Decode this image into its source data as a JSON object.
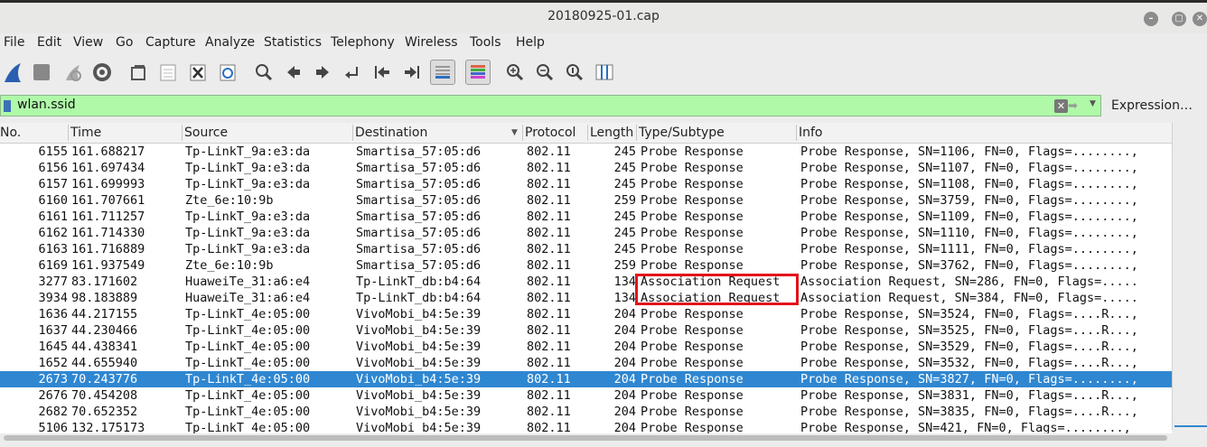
{
  "window": {
    "title": "20180925-01.cap",
    "minimize": "–",
    "maximize": "▢",
    "close": "✕"
  },
  "menu": [
    "File",
    "Edit",
    "View",
    "Go",
    "Capture",
    "Analyze",
    "Statistics",
    "Telephony",
    "Wireless",
    "Tools",
    "Help"
  ],
  "toolbar": [
    "shark-fin-icon",
    "stop-icon",
    "restart-icon",
    "options-gear-icon",
    "open-folder-icon",
    "save-file-icon",
    "close-file-icon",
    "reload-icon",
    "find-icon",
    "back-arrow-icon",
    "forward-arrow-icon",
    "go-to-packet-icon",
    "first-packet-icon",
    "last-packet-icon",
    "autoscroll-icon",
    "colorize-icon",
    "zoom-in-icon",
    "zoom-out-icon",
    "normal-size-icon",
    "resize-columns-icon"
  ],
  "filter": {
    "value": "wlan.ssid",
    "expression_label": "Expression…"
  },
  "columns": [
    "No.",
    "Time",
    "Source",
    "Destination",
    "Protocol",
    "Length",
    "Type/Subtype",
    "Info"
  ],
  "packets": [
    {
      "no": "6155",
      "time": "161.688217",
      "src": "Tp-LinkT_9a:e3:da",
      "dst": "Smartisa_57:05:d6",
      "proto": "802.11",
      "len": "245",
      "type": "Probe Response",
      "info": "Probe Response, SN=1106, FN=0, Flags=........,"
    },
    {
      "no": "6156",
      "time": "161.697434",
      "src": "Tp-LinkT_9a:e3:da",
      "dst": "Smartisa_57:05:d6",
      "proto": "802.11",
      "len": "245",
      "type": "Probe Response",
      "info": "Probe Response, SN=1107, FN=0, Flags=........,"
    },
    {
      "no": "6157",
      "time": "161.699993",
      "src": "Tp-LinkT_9a:e3:da",
      "dst": "Smartisa_57:05:d6",
      "proto": "802.11",
      "len": "245",
      "type": "Probe Response",
      "info": "Probe Response, SN=1108, FN=0, Flags=........,"
    },
    {
      "no": "6160",
      "time": "161.707661",
      "src": "Zte_6e:10:9b",
      "dst": "Smartisa_57:05:d6",
      "proto": "802.11",
      "len": "259",
      "type": "Probe Response",
      "info": "Probe Response, SN=3759, FN=0, Flags=........,"
    },
    {
      "no": "6161",
      "time": "161.711257",
      "src": "Tp-LinkT_9a:e3:da",
      "dst": "Smartisa_57:05:d6",
      "proto": "802.11",
      "len": "245",
      "type": "Probe Response",
      "info": "Probe Response, SN=1109, FN=0, Flags=........,"
    },
    {
      "no": "6162",
      "time": "161.714330",
      "src": "Tp-LinkT_9a:e3:da",
      "dst": "Smartisa_57:05:d6",
      "proto": "802.11",
      "len": "245",
      "type": "Probe Response",
      "info": "Probe Response, SN=1110, FN=0, Flags=........,"
    },
    {
      "no": "6163",
      "time": "161.716889",
      "src": "Tp-LinkT_9a:e3:da",
      "dst": "Smartisa_57:05:d6",
      "proto": "802.11",
      "len": "245",
      "type": "Probe Response",
      "info": "Probe Response, SN=1111, FN=0, Flags=........,"
    },
    {
      "no": "6169",
      "time": "161.937549",
      "src": "Zte_6e:10:9b",
      "dst": "Smartisa_57:05:d6",
      "proto": "802.11",
      "len": "259",
      "type": "Probe Response",
      "info": "Probe Response, SN=3762, FN=0, Flags=........,"
    },
    {
      "no": "3277",
      "time": "83.171602",
      "src": "HuaweiTe_31:a6:e4",
      "dst": "Tp-LinkT_db:b4:64",
      "proto": "802.11",
      "len": "134",
      "type": "Association Request",
      "info": "Association Request, SN=286, FN=0, Flags=....."
    },
    {
      "no": "3934",
      "time": "98.183889",
      "src": "HuaweiTe_31:a6:e4",
      "dst": "Tp-LinkT_db:b4:64",
      "proto": "802.11",
      "len": "134",
      "type": "Association Request",
      "info": "Association Request, SN=384, FN=0, Flags=....."
    },
    {
      "no": "1636",
      "time": "44.217155",
      "src": "Tp-LinkT_4e:05:00",
      "dst": "VivoMobi_b4:5e:39",
      "proto": "802.11",
      "len": "204",
      "type": "Probe Response",
      "info": "Probe Response, SN=3524, FN=0, Flags=....R...,"
    },
    {
      "no": "1637",
      "time": "44.230466",
      "src": "Tp-LinkT_4e:05:00",
      "dst": "VivoMobi_b4:5e:39",
      "proto": "802.11",
      "len": "204",
      "type": "Probe Response",
      "info": "Probe Response, SN=3525, FN=0, Flags=....R...,"
    },
    {
      "no": "1645",
      "time": "44.438341",
      "src": "Tp-LinkT_4e:05:00",
      "dst": "VivoMobi_b4:5e:39",
      "proto": "802.11",
      "len": "204",
      "type": "Probe Response",
      "info": "Probe Response, SN=3529, FN=0, Flags=....R...,"
    },
    {
      "no": "1652",
      "time": "44.655940",
      "src": "Tp-LinkT_4e:05:00",
      "dst": "VivoMobi_b4:5e:39",
      "proto": "802.11",
      "len": "204",
      "type": "Probe Response",
      "info": "Probe Response, SN=3532, FN=0, Flags=....R...,"
    },
    {
      "no": "2673",
      "time": "70.243776",
      "src": "Tp-LinkT_4e:05:00",
      "dst": "VivoMobi_b4:5e:39",
      "proto": "802.11",
      "len": "204",
      "type": "Probe Response",
      "info": "Probe Response, SN=3827, FN=0, Flags=........,",
      "selected": true
    },
    {
      "no": "2676",
      "time": "70.454208",
      "src": "Tp-LinkT_4e:05:00",
      "dst": "VivoMobi_b4:5e:39",
      "proto": "802.11",
      "len": "204",
      "type": "Probe Response",
      "info": "Probe Response, SN=3831, FN=0, Flags=....R...,"
    },
    {
      "no": "2682",
      "time": "70.652352",
      "src": "Tp-LinkT_4e:05:00",
      "dst": "VivoMobi_b4:5e:39",
      "proto": "802.11",
      "len": "204",
      "type": "Probe Response",
      "info": "Probe Response, SN=3835, FN=0, Flags=....R...,"
    },
    {
      "no": "5106",
      "time": "132.175173",
      "src": "Tp-LinkT_4e:05:00",
      "dst": "VivoMobi_b4:5e:39",
      "proto": "802.11",
      "len": "204",
      "type": "Probe Response",
      "info": "Probe Response, SN=421, FN=0, Flags=........,"
    }
  ],
  "colors": {
    "filter_bg": "#aff9a8",
    "selection": "#2f87d1",
    "highlight_box": "#e3121b"
  }
}
